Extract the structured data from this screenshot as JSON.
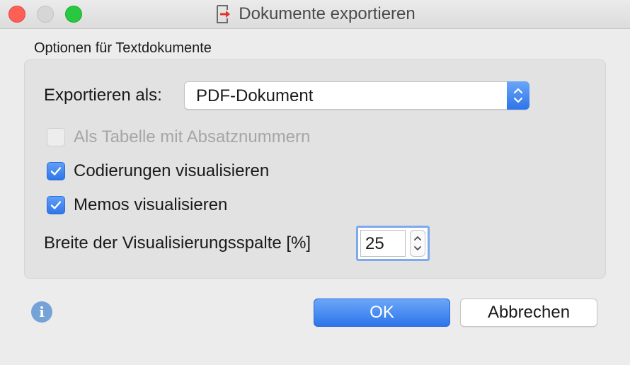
{
  "window": {
    "title": "Dokumente exportieren",
    "title_icon": "export-document-icon"
  },
  "group": {
    "label": "Optionen für Textdokumente"
  },
  "export_as": {
    "label": "Exportieren als:",
    "selected": "PDF-Dokument"
  },
  "options": [
    {
      "label": "Als Tabelle mit Absatznummern",
      "checked": false,
      "enabled": false
    },
    {
      "label": "Codierungen visualisieren",
      "checked": true,
      "enabled": true
    },
    {
      "label": "Memos visualisieren",
      "checked": true,
      "enabled": true
    }
  ],
  "column_width": {
    "label": "Breite der Visualisierungsspalte [%]",
    "value": "25"
  },
  "footer": {
    "info_icon": "info-icon",
    "ok_label": "OK",
    "cancel_label": "Abbrechen"
  },
  "colors": {
    "accent": "#2f76e9",
    "close": "#fe5f57",
    "maximize": "#28c840",
    "title_icon_arrow": "#e0362b"
  }
}
